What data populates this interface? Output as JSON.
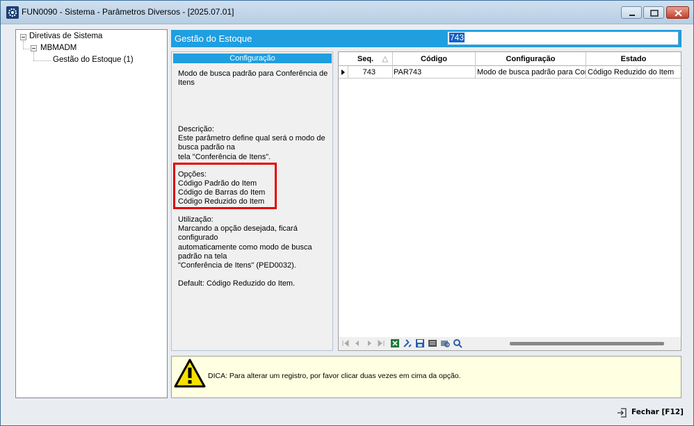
{
  "window": {
    "title": "FUN0090 - Sistema - Parâmetros Diversos - [2025.07.01]"
  },
  "tree": {
    "root": "Diretivas de Sistema",
    "child": "MBMADM",
    "leaf": "Gestão do Estoque (1)"
  },
  "header": {
    "title": "Gestão do Estoque",
    "search_value": "743"
  },
  "config": {
    "header": "Configuração",
    "name": "Modo de busca padrão para Conferência de Itens",
    "descricao_label": "Descrição:",
    "descricao": "Este parâmetro define qual será o modo de busca padrão na\ntela \"Conferência de Itens\".",
    "opcoes_label": "Opções:",
    "opcoes": [
      "Código Padrão do Item",
      "Código de Barras do Item",
      "Código Reduzido do Item"
    ],
    "utilizacao_label": "Utilização:",
    "utilizacao": "Marcando a opção desejada, ficará configurado\nautomaticamente como modo de busca padrão na tela\n\"Conferência de Itens\" (PED0032).",
    "default": "Default: Código Reduzido do Item."
  },
  "grid": {
    "columns": [
      "Seq.",
      "Código",
      "Configuração",
      "Estado"
    ],
    "rows": [
      {
        "seq": "743",
        "codigo": "PAR743",
        "configuracao": "Modo de busca padrão para Conferência de Itens",
        "estado": "Código Reduzido do Item"
      }
    ]
  },
  "tip": {
    "text": "DICA: Para alterar um registro, por favor clicar duas vezes em cima da opção."
  },
  "footer": {
    "close_label": "Fechar [F12]"
  },
  "colors": {
    "accent": "#1f9ee0",
    "highlight_border": "#e00000",
    "tip_background": "#ffffe1"
  }
}
